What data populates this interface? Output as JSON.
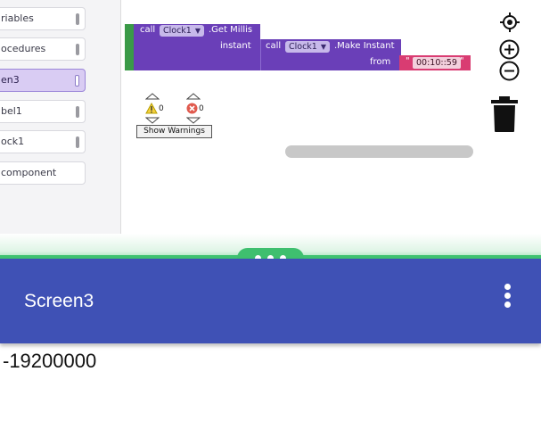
{
  "sidebar": {
    "items": [
      {
        "label": "riables",
        "selected": false
      },
      {
        "label": "ocedures",
        "selected": false
      },
      {
        "label": "en3",
        "selected": true
      },
      {
        "label": "bel1",
        "selected": false
      },
      {
        "label": "ock1",
        "selected": false
      },
      {
        "label": "component",
        "selected": false
      }
    ]
  },
  "blocks": {
    "outer": {
      "call": "call",
      "component": "Clock1",
      "method": ".Get Millis",
      "param": "instant"
    },
    "inner": {
      "call": "call",
      "component": "Clock1",
      "method": ".Make Instant",
      "param": "from"
    },
    "string": {
      "open_quote": "\"",
      "value": "00:10::59",
      "close_quote": "\""
    }
  },
  "warnings": {
    "warning_count": "0",
    "error_count": "0",
    "button_label": "Show Warnings"
  },
  "tools": {
    "icons": [
      "target-icon",
      "zoom-in-icon",
      "zoom-out-icon",
      "trash-icon"
    ]
  },
  "splitter": {
    "handle_icon": "ellipsis-horizontal-icon",
    "accent": "#3fbf6f"
  },
  "app": {
    "title": "Screen3",
    "appbar_color": "#3f51b5",
    "menu_icon": "more-vert-icon",
    "result_text": "-19200000"
  }
}
